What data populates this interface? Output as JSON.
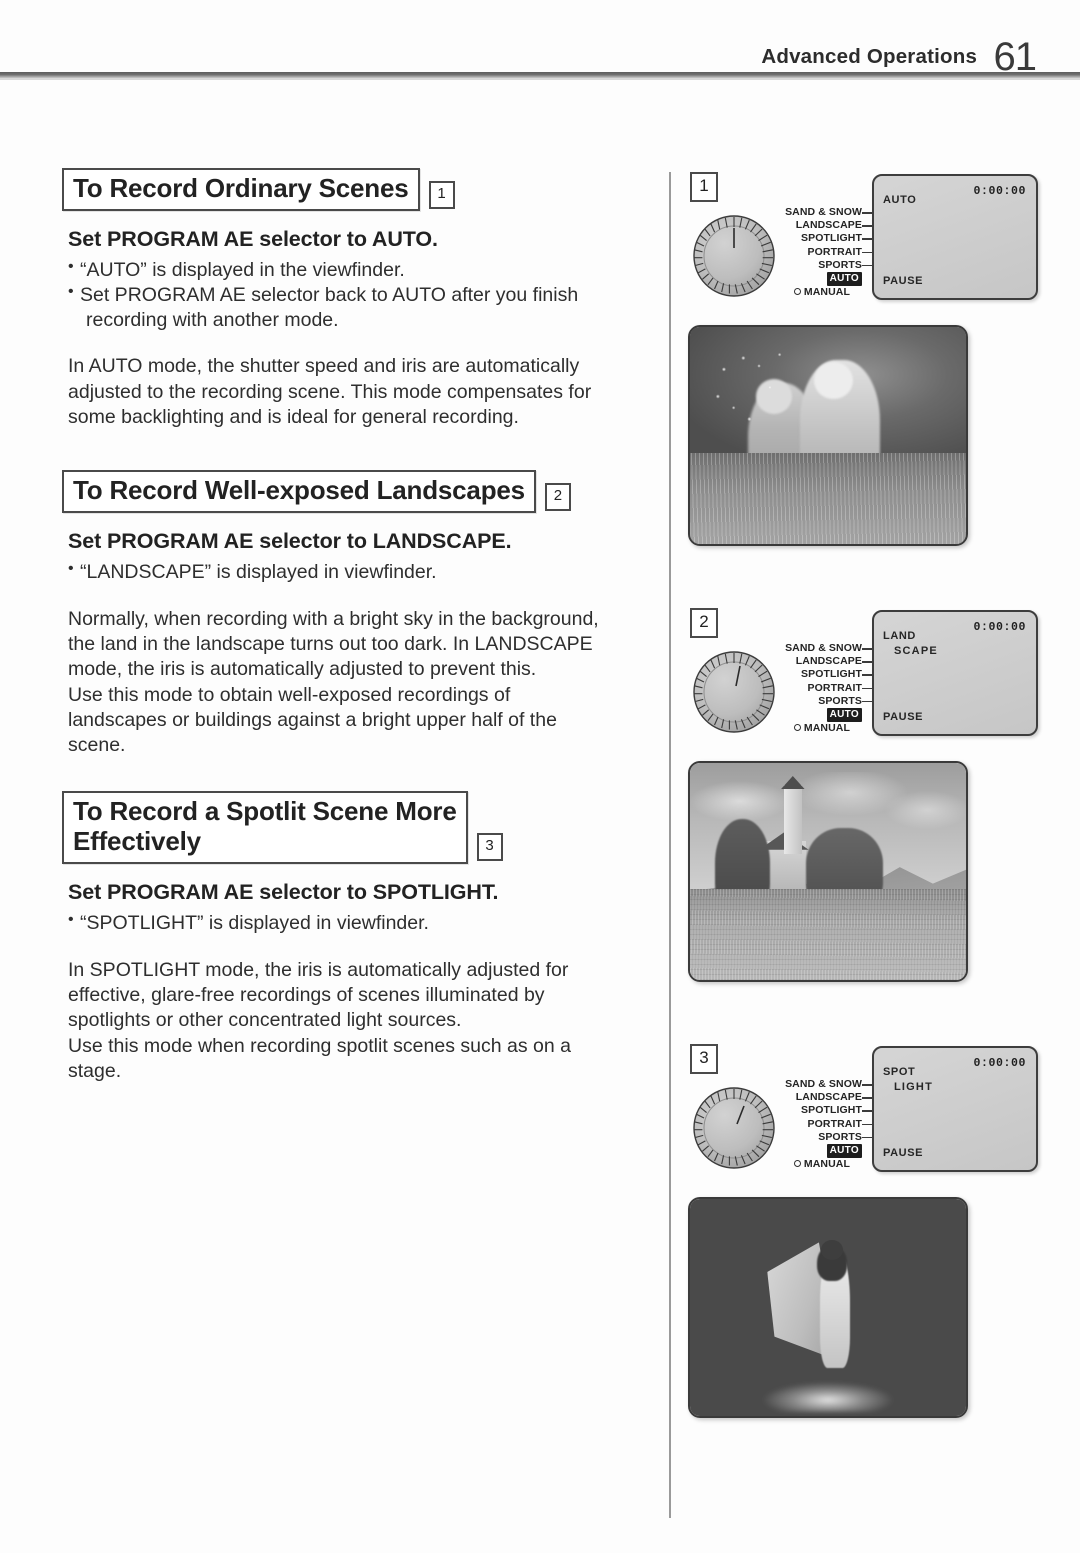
{
  "header": {
    "title": "Advanced Operations",
    "page_number": "61"
  },
  "sections": [
    {
      "heading": "To Record Ordinary Scenes",
      "number": "1",
      "subheading": "Set PROGRAM AE selector to AUTO.",
      "bullets": [
        {
          "text": "“AUTO” is displayed in the viewfinder."
        },
        {
          "text": "Set PROGRAM AE selector back to AUTO after you finish",
          "continuation": "recording with another mode."
        }
      ],
      "paragraph": "In AUTO mode, the shutter speed and iris are automatically\nadjusted to the recording scene. This mode compensates for\nsome backlighting and is ideal for general recording."
    },
    {
      "heading": "To Record Well-exposed Landscapes",
      "number": "2",
      "subheading": "Set PROGRAM AE selector to LANDSCAPE.",
      "bullets": [
        {
          "text": "“LANDSCAPE” is displayed in viewfinder."
        }
      ],
      "paragraph": "Normally, when recording with a bright sky in the background,\nthe land in the landscape turns out too dark. In LANDSCAPE\nmode, the iris is automatically adjusted to prevent this.\nUse this mode to obtain well-exposed recordings of\nlandscapes or buildings against a bright upper half of the\nscene."
    },
    {
      "heading": "To Record a Spotlit Scene More\nEffectively",
      "number": "3",
      "subheading": "Set PROGRAM AE selector to SPOTLIGHT.",
      "bullets": [
        {
          "text": "“SPOTLIGHT” is displayed in viewfinder."
        }
      ],
      "paragraph": "In SPOTLIGHT mode, the iris is automatically adjusted for\neffective, glare-free recordings of scenes illuminated by\nspotlights or other concentrated light sources.\nUse this mode when recording spotlit scenes such as on a\nstage."
    }
  ],
  "dial": {
    "modes": [
      "SAND & SNOW",
      "LANDSCAPE",
      "SPOTLIGHT",
      "PORTRAIT",
      "SPORTS"
    ],
    "auto_label": "AUTO",
    "manual_label": "MANUAL"
  },
  "figures": [
    {
      "number": "1",
      "viewfinder": {
        "mode_line1": "AUTO",
        "mode_line2": "",
        "timecode": "0:00:00",
        "status": "PAUSE"
      },
      "photo_caption": "two children sitting in grass with soap bubbles against a dark background"
    },
    {
      "number": "2",
      "viewfinder": {
        "mode_line1": "LAND",
        "mode_line2": "SCAPE",
        "timecode": "0:00:00",
        "status": "PAUSE"
      },
      "photo_caption": "church with tall tower among trees with mountains and a flower meadow"
    },
    {
      "number": "3",
      "viewfinder": {
        "mode_line1": "SPOT",
        "mode_line2": "LIGHT",
        "timecode": "0:00:00",
        "status": "PAUSE"
      },
      "photo_caption": "dancer holding a flowing cloth lit by a spotlight on a dark stage"
    }
  ],
  "colors": {
    "text": "#2e2e2e",
    "rule": "#5d5d5d",
    "viewfinder_bg": "#cfcfcf",
    "chip_bg": "#1d1d1d"
  }
}
